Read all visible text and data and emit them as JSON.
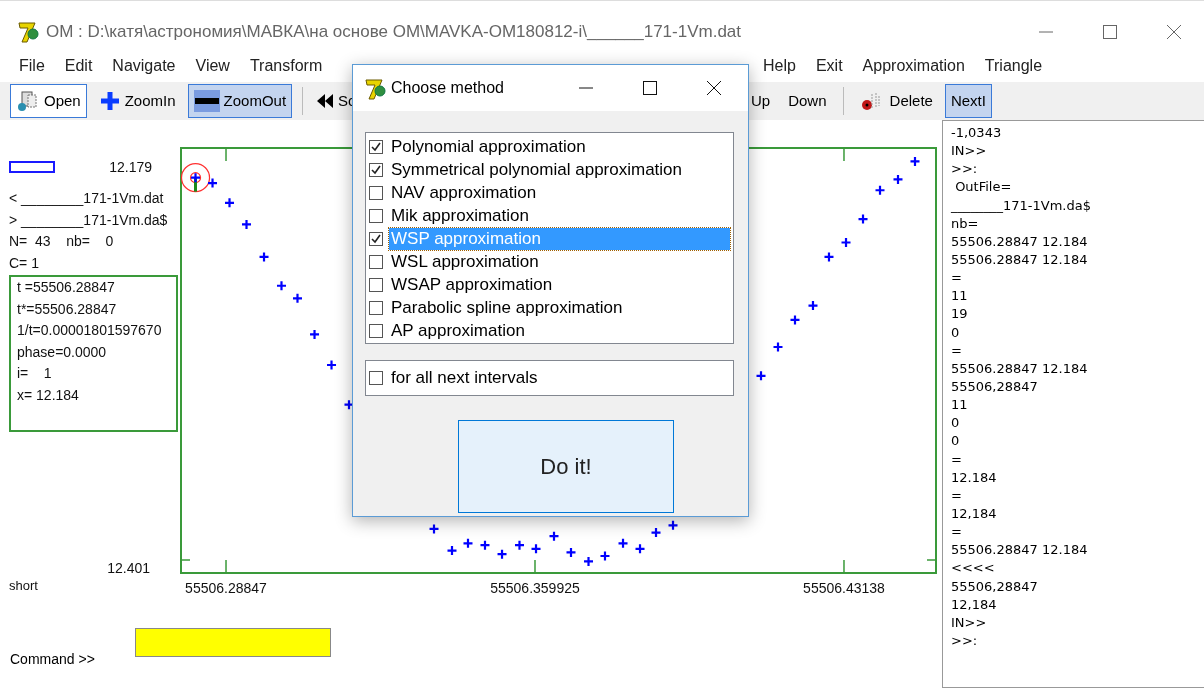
{
  "window": {
    "title": "OM : D:\\катя\\астрономия\\МАВКА\\на основе ОМ\\MAVKA-OM180812-i\\______171-1Vm.dat"
  },
  "menu": {
    "left": [
      "File",
      "Edit",
      "Navigate",
      "View",
      "Transform"
    ],
    "right": [
      "Help",
      "Exit",
      "Approximation",
      "Triangle"
    ]
  },
  "toolbar": {
    "left": [
      {
        "label": "Open",
        "kind": "open",
        "focused": true,
        "pressed": false
      },
      {
        "label": "ZoomIn",
        "kind": "zoomin",
        "focused": false,
        "pressed": false
      },
      {
        "label": "ZoomOut",
        "kind": "zoomout",
        "focused": false,
        "pressed": true
      },
      {
        "label": "Sc",
        "kind": "back",
        "focused": false,
        "pressed": false
      }
    ],
    "right": [
      {
        "label": "Up",
        "kind": "text",
        "focused": false,
        "pressed": false
      },
      {
        "label": "Down",
        "kind": "text",
        "focused": false,
        "pressed": false
      },
      {
        "label": "Delete",
        "kind": "delete",
        "focused": false,
        "pressed": false
      },
      {
        "label": "NextI",
        "kind": "text",
        "focused": false,
        "pressed": true
      }
    ]
  },
  "left_panel": {
    "files": [
      "< ________171-1Vm.dat",
      "> ________171-1Vm.da$"
    ],
    "counts": [
      "N=  43    nb=    0",
      "C= 1"
    ],
    "info": [
      "t =55506.28847",
      "t*=55506.28847",
      "1/t=0.00001801597670",
      "phase=0.0000",
      "i=    1",
      "x= 12.184"
    ],
    "mode": "short"
  },
  "chart_data": {
    "type": "scatter",
    "x": [
      55506.28142,
      55506.28535,
      55506.28928,
      55506.29321,
      55506.29726,
      55506.3013,
      55506.305,
      55506.30894,
      55506.31287,
      55506.31691,
      55506.33657,
      55506.34073,
      55506.34443,
      55506.34836,
      55506.3523,
      55506.35634,
      55506.36016,
      55506.36432,
      55506.36825,
      55506.3723,
      55506.37611,
      55506.38028,
      55506.38421,
      55506.38791,
      55506.39184,
      55506.41219,
      55506.41612,
      55506.42005,
      55506.42421,
      55506.42791,
      55506.43185,
      55506.43578,
      55506.43971,
      55506.44387,
      55506.4478
    ],
    "series": [
      {
        "color": "#0000ff",
        "values": [
          12.184,
          12.187,
          12.198,
          12.21,
          12.228,
          12.244,
          12.251,
          12.271,
          12.288,
          12.31,
          12.379,
          12.391,
          12.387,
          12.388,
          12.393,
          12.388,
          12.39,
          12.383,
          12.392,
          12.397,
          12.394,
          12.387,
          12.39,
          12.381,
          12.377,
          12.294,
          12.278,
          12.263,
          12.255,
          12.228,
          12.22,
          12.207,
          12.191,
          12.185,
          12.175
        ]
      }
    ],
    "xlim": [
      55506.27783,
      55506.45289
    ],
    "ylim": [
      12.404,
      12.167
    ],
    "xticks": [
      55506.28847,
      55506.359925,
      55506.43138
    ],
    "yticks": [
      12.179,
      12.401
    ]
  },
  "command": {
    "label": "Command >>"
  },
  "log": [
    "-1,0343",
    "IN>>",
    ">>:",
    " OutFile=",
    "________171-1Vm.da$",
    "nb=",
    "55506.28847 12.184",
    "55506.28847 12.184",
    "=",
    "11",
    "19",
    "0",
    "=",
    "55506.28847 12.184",
    "55506,28847",
    "11",
    "0",
    "0",
    "=",
    "12.184",
    "=",
    "12,184",
    "=",
    "55506.28847 12.184",
    "<<<<",
    "55506,28847",
    "12,184",
    "IN>>",
    ">>:"
  ],
  "dialog": {
    "title": "Choose method",
    "methods": [
      {
        "label": "Polynomial approximation",
        "checked": true,
        "selected": false
      },
      {
        "label": "Symmetrical polynomial approximation",
        "checked": true,
        "selected": false
      },
      {
        "label": "NAV approximation",
        "checked": false,
        "selected": false
      },
      {
        "label": "Mik approximation",
        "checked": false,
        "selected": false
      },
      {
        "label": "WSP approximation",
        "checked": true,
        "selected": true
      },
      {
        "label": "WSL approximation",
        "checked": false,
        "selected": false
      },
      {
        "label": "WSAP approximation",
        "checked": false,
        "selected": false
      },
      {
        "label": "Parabolic spline approximation",
        "checked": false,
        "selected": false
      },
      {
        "label": "AP approximation",
        "checked": false,
        "selected": false
      }
    ],
    "option": {
      "label": "for all next intervals",
      "checked": false
    },
    "button": "Do it!"
  }
}
